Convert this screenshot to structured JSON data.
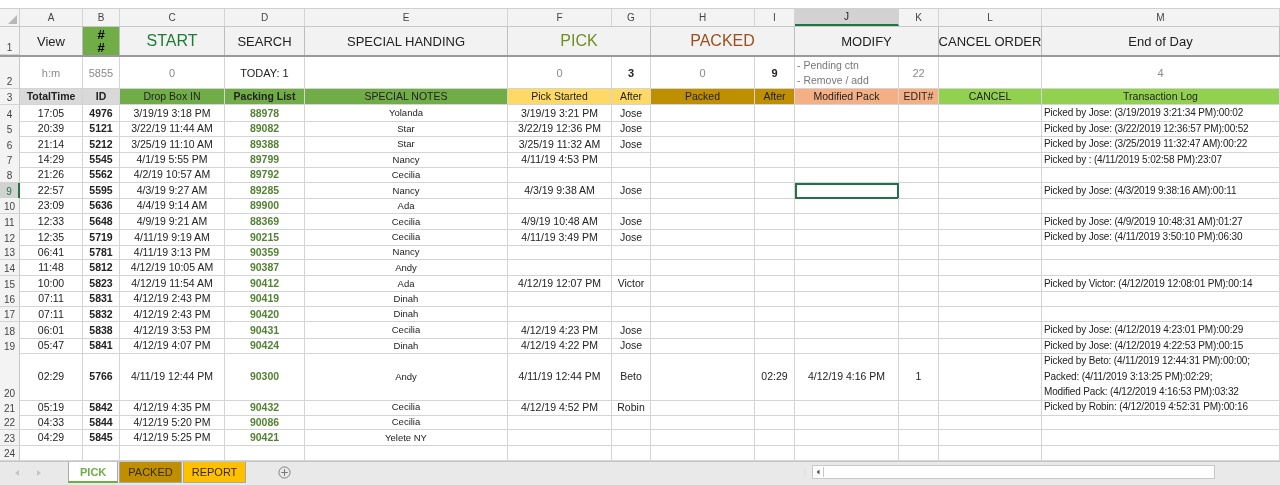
{
  "columns": [
    {
      "label": "A",
      "selected": false
    },
    {
      "label": "B",
      "selected": false
    },
    {
      "label": "C",
      "selected": false
    },
    {
      "label": "D",
      "selected": false
    },
    {
      "label": "E",
      "selected": false
    },
    {
      "label": "F",
      "selected": false
    },
    {
      "label": "G",
      "selected": false
    },
    {
      "label": "H",
      "selected": false
    },
    {
      "label": "I",
      "selected": false
    },
    {
      "label": "J",
      "selected": true
    },
    {
      "label": "K",
      "selected": false
    },
    {
      "label": "L",
      "selected": false
    },
    {
      "label": "M",
      "selected": false
    }
  ],
  "title_row": {
    "number": "1",
    "cells": [
      {
        "text": "View",
        "kind": "plain",
        "color": "#222222"
      },
      {
        "lines": [
          "#",
          "#"
        ],
        "kind": "badge"
      },
      {
        "text": "START",
        "kind": "large",
        "color": "#1e7b34"
      },
      {
        "text": "SEARCH",
        "kind": "plain",
        "color": "#222222"
      },
      {
        "text": "SPECIAL HANDING",
        "kind": "plain",
        "color": "#222222"
      },
      {
        "text": "PICK",
        "kind": "large",
        "color": "#6f8f1f"
      },
      {
        "text": "PACKED",
        "kind": "large",
        "color": "#9c4f1c"
      },
      {
        "text": "MODIFY",
        "kind": "plain",
        "color": "#222222"
      },
      {
        "text": "CANCEL ORDER",
        "kind": "plain",
        "color": "#222222"
      },
      {
        "text": "End of Day",
        "kind": "plain",
        "color": "#222222"
      }
    ]
  },
  "summary_row": {
    "number": "2",
    "cells": [
      {
        "text": "h:m",
        "kind": "muted"
      },
      {
        "text": "5855",
        "kind": "muted"
      },
      {
        "text": "0",
        "kind": "muted"
      },
      {
        "text": "TODAY: 1",
        "kind": "plain"
      },
      {
        "kind": "empty"
      },
      {
        "text": "0",
        "kind": "muted"
      },
      {
        "text": "3",
        "kind": "bold"
      },
      {
        "text": "0",
        "kind": "muted"
      },
      {
        "text": "9",
        "kind": "bold"
      },
      {
        "lines": [
          "- Pending ctn",
          "- Remove / add"
        ],
        "kind": "note"
      },
      {
        "text": "22",
        "kind": "muted"
      },
      {
        "kind": "empty"
      },
      {
        "text": "4",
        "kind": "muted"
      }
    ]
  },
  "heading_row": {
    "number": "3",
    "cells": [
      {
        "text": "TotalTime",
        "bold": true,
        "color": "#d9d9d9"
      },
      {
        "text": "ID",
        "bold": true,
        "color": "#d9d9d9"
      },
      {
        "text": "Drop Box IN",
        "bold": false,
        "color": "#70ad47"
      },
      {
        "text": "Packing List",
        "bold": true,
        "color": "#70ad47"
      },
      {
        "text": "SPECIAL NOTES",
        "bold": false,
        "color": "#70ad47"
      },
      {
        "text": "Pick Started",
        "bold": false,
        "color": "#ffd966"
      },
      {
        "text": "After",
        "bold": false,
        "color": "#ffd966"
      },
      {
        "text": "Packed",
        "bold": false,
        "color": "#bf8f00"
      },
      {
        "text": "After",
        "bold": false,
        "color": "#bf8f00"
      },
      {
        "text": "Modified Pack",
        "bold": false,
        "color": "#f4b084"
      },
      {
        "text": "EDIT#",
        "bold": false,
        "color": "#f4b084"
      },
      {
        "text": "CANCEL",
        "bold": false,
        "color": "#92d050"
      },
      {
        "text": "Transaction Log",
        "bold": false,
        "color": "#92d050"
      }
    ]
  },
  "rows": [
    {
      "number": "4",
      "selected": false,
      "total_time": "17:05",
      "id": "4976",
      "drop_box_in": "3/19/19 3:18 PM",
      "packing_list": "88978",
      "special_notes": "Yolanda",
      "pick_started": "3/19/19 3:21 PM",
      "pick_after": "Jose",
      "transaction_log": [
        "Picked by Jose: (3/19/2019 3:21:34 PM):00:02"
      ]
    },
    {
      "number": "5",
      "selected": false,
      "total_time": "20:39",
      "id": "5121",
      "drop_box_in": "3/22/19 11:44 AM",
      "packing_list": "89082",
      "special_notes": "Star",
      "pick_started": "3/22/19 12:36 PM",
      "pick_after": "Jose",
      "transaction_log": [
        "Picked by Jose: (3/22/2019 12:36:57 PM):00:52"
      ]
    },
    {
      "number": "6",
      "selected": false,
      "total_time": "21:14",
      "id": "5212",
      "drop_box_in": "3/25/19 11:10 AM",
      "packing_list": "89388",
      "special_notes": "Star",
      "pick_started": "3/25/19 11:32 AM",
      "pick_after": "Jose",
      "transaction_log": [
        "Picked by Jose: (3/25/2019 11:32:47 AM):00:22"
      ]
    },
    {
      "number": "7",
      "selected": false,
      "total_time": "14:29",
      "id": "5545",
      "drop_box_in": "4/1/19 5:55 PM",
      "packing_list": "89799",
      "special_notes": "Nancy",
      "pick_started": "4/11/19 4:53 PM",
      "transaction_log": [
        "Picked by : (4/11/2019 5:02:58 PM):23:07"
      ]
    },
    {
      "number": "8",
      "selected": false,
      "total_time": "21:26",
      "id": "5562",
      "drop_box_in": "4/2/19 10:57 AM",
      "packing_list": "89792",
      "special_notes": "Cecilia"
    },
    {
      "number": "9",
      "selected": true,
      "total_time": "22:57",
      "id": "5595",
      "drop_box_in": "4/3/19 9:27 AM",
      "packing_list": "89285",
      "special_notes": "Nancy",
      "pick_started": "4/3/19 9:38 AM",
      "pick_after": "Jose",
      "transaction_log": [
        "Picked by Jose: (4/3/2019 9:38:16 AM):00:11"
      ]
    },
    {
      "number": "10",
      "selected": false,
      "total_time": "23:09",
      "id": "5636",
      "drop_box_in": "4/4/19 9:14 AM",
      "packing_list": "89900",
      "special_notes": "Ada"
    },
    {
      "number": "11",
      "selected": false,
      "total_time": "12:33",
      "id": "5648",
      "drop_box_in": "4/9/19 9:21 AM",
      "packing_list": "88369",
      "special_notes": "Cecilia",
      "pick_started": "4/9/19 10:48 AM",
      "pick_after": "Jose",
      "transaction_log": [
        "Picked by Jose: (4/9/2019 10:48:31 AM):01:27"
      ]
    },
    {
      "number": "12",
      "selected": false,
      "total_time": "12:35",
      "id": "5719",
      "drop_box_in": "4/11/19 9:19 AM",
      "packing_list": "90215",
      "special_notes": "Cecilia",
      "pick_started": "4/11/19 3:49 PM",
      "pick_after": "Jose",
      "transaction_log": [
        "Picked by Jose: (4/11/2019 3:50:10 PM):06:30"
      ]
    },
    {
      "number": "13",
      "selected": false,
      "total_time": "06:41",
      "id": "5781",
      "drop_box_in": "4/11/19 3:13 PM",
      "packing_list": "90359",
      "special_notes": "Nancy"
    },
    {
      "number": "14",
      "selected": false,
      "total_time": "11:48",
      "id": "5812",
      "drop_box_in": "4/12/19 10:05 AM",
      "packing_list": "90387",
      "special_notes": "Andy"
    },
    {
      "number": "15",
      "selected": false,
      "total_time": "10:00",
      "id": "5823",
      "drop_box_in": "4/12/19 11:54 AM",
      "packing_list": "90412",
      "special_notes": "Ada",
      "pick_started": "4/12/19 12:07 PM",
      "pick_after": "Victor",
      "transaction_log": [
        "Picked by Victor: (4/12/2019 12:08:01 PM):00:14"
      ]
    },
    {
      "number": "16",
      "selected": false,
      "total_time": "07:11",
      "id": "5831",
      "drop_box_in": "4/12/19 2:43 PM",
      "packing_list": "90419",
      "special_notes": "Dinah"
    },
    {
      "number": "17",
      "selected": false,
      "total_time": "07:11",
      "id": "5832",
      "drop_box_in": "4/12/19 2:43 PM",
      "packing_list": "90420",
      "special_notes": "Dinah"
    },
    {
      "number": "18",
      "selected": false,
      "total_time": "06:01",
      "id": "5838",
      "drop_box_in": "4/12/19 3:53 PM",
      "packing_list": "90431",
      "special_notes": "Cecilia",
      "pick_started": "4/12/19 4:23 PM",
      "pick_after": "Jose",
      "transaction_log": [
        "Picked by Jose: (4/12/2019 4:23:01 PM):00:29"
      ]
    },
    {
      "number": "19",
      "selected": false,
      "total_time": "05:47",
      "id": "5841",
      "drop_box_in": "4/12/19 4:07 PM",
      "packing_list": "90424",
      "special_notes": "Dinah",
      "pick_started": "4/12/19 4:22 PM",
      "pick_after": "Jose",
      "transaction_log": [
        "Picked by Jose: (4/12/2019 4:22:53 PM):00:15"
      ]
    },
    {
      "number": "20",
      "selected": false,
      "total_time": "02:29",
      "id": "5766",
      "drop_box_in": "4/11/19 12:44 PM",
      "packing_list": "90300",
      "special_notes": "Andy",
      "pick_started": "4/11/19 12:44 PM",
      "pick_after": "Beto",
      "packed_after": "02:29",
      "modified_pack": "4/12/19 4:16 PM",
      "edit_no": "1",
      "transaction_log": [
        "Picked by Beto: (4/11/2019 12:44:31 PM):00:00;",
        "Packed: (4/11/2019 3:13:25 PM):02:29;",
        "Modified Pack: (4/12/2019 4:16:53 PM):03:32"
      ]
    },
    {
      "number": "21",
      "selected": false,
      "total_time": "05:19",
      "id": "5842",
      "drop_box_in": "4/12/19 4:35 PM",
      "packing_list": "90432",
      "special_notes": "Cecilia",
      "pick_started": "4/12/19 4:52 PM",
      "pick_after": "Robin",
      "transaction_log": [
        "Picked by Robin: (4/12/2019 4:52:31 PM):00:16"
      ]
    },
    {
      "number": "22",
      "selected": false,
      "total_time": "04:33",
      "id": "5844",
      "drop_box_in": "4/12/19 5:20 PM",
      "packing_list": "90086",
      "special_notes": "Cecilia"
    },
    {
      "number": "23",
      "selected": false,
      "total_time": "04:29",
      "id": "5845",
      "drop_box_in": "4/12/19 5:25 PM",
      "packing_list": "90421",
      "special_notes": "Yelete NY"
    },
    {
      "number": "24",
      "selected": false
    }
  ],
  "sheet_tabs": [
    {
      "label": "PICK",
      "selected": true,
      "color": "#70ad47"
    },
    {
      "label": "PACKED",
      "selected": false,
      "color": "#bf8f00"
    },
    {
      "label": "REPORT",
      "selected": false,
      "color": "#ffc000"
    }
  ]
}
